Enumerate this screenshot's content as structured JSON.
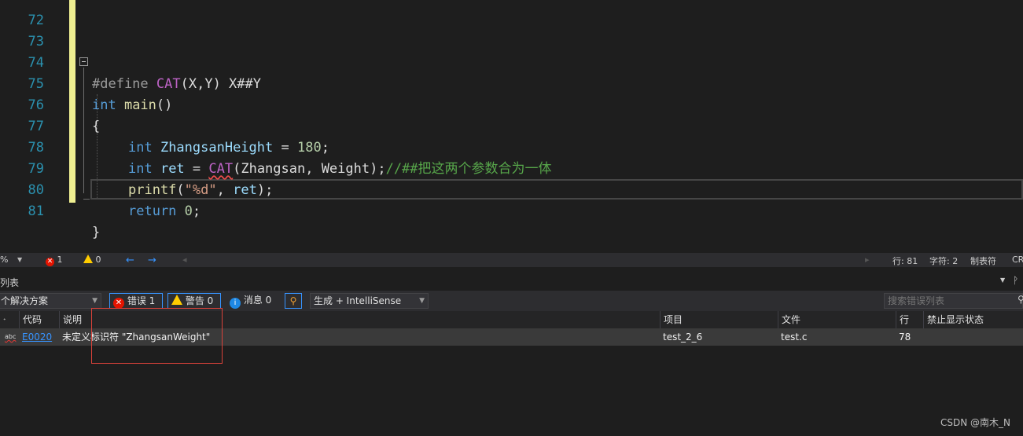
{
  "editor": {
    "lines": [
      {
        "num": "72"
      },
      {
        "num": "73"
      },
      {
        "num": "74"
      },
      {
        "num": "75"
      },
      {
        "num": "76"
      },
      {
        "num": "77"
      },
      {
        "num": "78"
      },
      {
        "num": "79"
      },
      {
        "num": "80"
      },
      {
        "num": "81"
      }
    ],
    "code": {
      "l74_define": "#define",
      "l74_name": "CAT",
      "l74_rest": "(X,Y) X##Y",
      "l75_kw": "int",
      "l75_fn": " main",
      "l75_rest": "()",
      "l76": "{",
      "l77_kw": "int",
      "l77_id": " ZhangsanHeight",
      "l77_op": " = ",
      "l77_num": "180",
      "l77_end": ";",
      "l78_kw": "int",
      "l78_id": " ret",
      "l78_op": " = ",
      "l78_mac": "CAT",
      "l78_args": "(Zhangsan, Weight);",
      "l78_cmt": "//##把这两个参数合为一体",
      "l79_fn": "printf",
      "l79_p1": "(",
      "l79_str": "\"%d\"",
      "l79_p2": ", ",
      "l79_id": "ret",
      "l79_p3": ");",
      "l80_kw": "return",
      "l80_num": " 0",
      "l80_end": ";",
      "l81": "}"
    }
  },
  "editor_status": {
    "zoom": "%",
    "errors": "1",
    "warnings": "0",
    "line": "行: 81",
    "char": "字符: 2",
    "tabs": "制表符",
    "eol": "CR"
  },
  "panel": {
    "title": "列表",
    "scope_label": "个解决方案",
    "errors_toggle": "错误 1",
    "warnings_toggle": "警告 0",
    "messages_toggle": "消息 0",
    "build_filter": "生成 + IntelliSense",
    "search_placeholder": "搜索错误列表",
    "columns": {
      "code": "代码",
      "description": "说明",
      "project": "项目",
      "file": "文件",
      "line": "行",
      "suppression": "禁止显示状态"
    },
    "row": {
      "code": "E0020",
      "description": "未定义标识符 \"ZhangsanWeight\"",
      "project": "test_2_6",
      "file": "test.c",
      "line": "78",
      "suppression": ""
    }
  },
  "watermark": "CSDN @南木_N"
}
